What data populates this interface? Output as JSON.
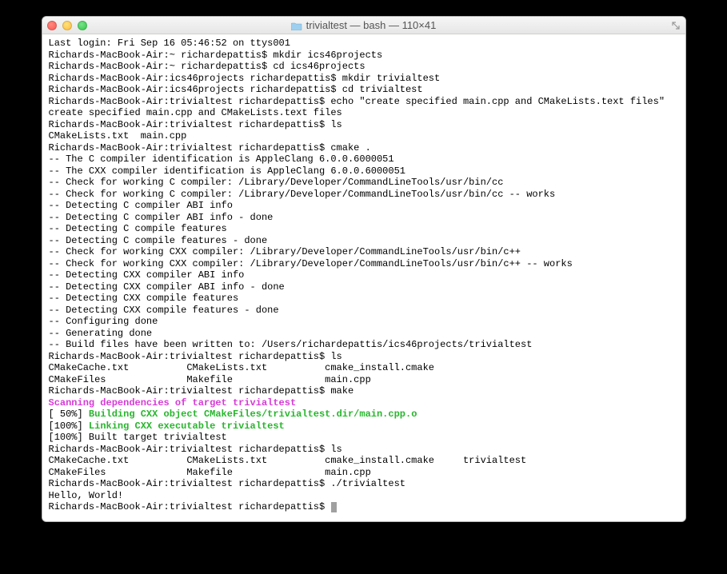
{
  "window": {
    "title": "trivialtest — bash — 110×41",
    "folder_icon": "folder-icon"
  },
  "traffic": {
    "close": "close",
    "minimize": "minimize",
    "zoom": "zoom"
  },
  "lines": [
    {
      "text": "Last login: Fri Sep 16 05:46:52 on ttys001"
    },
    {
      "text": "Richards-MacBook-Air:~ richardepattis$ mkdir ics46projects"
    },
    {
      "text": "Richards-MacBook-Air:~ richardepattis$ cd ics46projects"
    },
    {
      "text": "Richards-MacBook-Air:ics46projects richardepattis$ mkdir trivialtest"
    },
    {
      "text": "Richards-MacBook-Air:ics46projects richardepattis$ cd trivialtest"
    },
    {
      "text": "Richards-MacBook-Air:trivialtest richardepattis$ echo \"create specified main.cpp and CMakeLists.text files\""
    },
    {
      "text": "create specified main.cpp and CMakeLists.text files"
    },
    {
      "text": "Richards-MacBook-Air:trivialtest richardepattis$ ls"
    },
    {
      "text": "CMakeLists.txt  main.cpp"
    },
    {
      "text": "Richards-MacBook-Air:trivialtest richardepattis$ cmake ."
    },
    {
      "text": "-- The C compiler identification is AppleClang 6.0.0.6000051"
    },
    {
      "text": "-- The CXX compiler identification is AppleClang 6.0.0.6000051"
    },
    {
      "text": "-- Check for working C compiler: /Library/Developer/CommandLineTools/usr/bin/cc"
    },
    {
      "text": "-- Check for working C compiler: /Library/Developer/CommandLineTools/usr/bin/cc -- works"
    },
    {
      "text": "-- Detecting C compiler ABI info"
    },
    {
      "text": "-- Detecting C compiler ABI info - done"
    },
    {
      "text": "-- Detecting C compile features"
    },
    {
      "text": "-- Detecting C compile features - done"
    },
    {
      "text": "-- Check for working CXX compiler: /Library/Developer/CommandLineTools/usr/bin/c++"
    },
    {
      "text": "-- Check for working CXX compiler: /Library/Developer/CommandLineTools/usr/bin/c++ -- works"
    },
    {
      "text": "-- Detecting CXX compiler ABI info"
    },
    {
      "text": "-- Detecting CXX compiler ABI info - done"
    },
    {
      "text": "-- Detecting CXX compile features"
    },
    {
      "text": "-- Detecting CXX compile features - done"
    },
    {
      "text": "-- Configuring done"
    },
    {
      "text": "-- Generating done"
    },
    {
      "text": "-- Build files have been written to: /Users/richardepattis/ics46projects/trivialtest"
    },
    {
      "text": "Richards-MacBook-Air:trivialtest richardepattis$ ls"
    },
    {
      "text": "CMakeCache.txt          CMakeLists.txt          cmake_install.cmake"
    },
    {
      "text": "CMakeFiles              Makefile                main.cpp"
    },
    {
      "text": "Richards-MacBook-Air:trivialtest richardepattis$ make"
    },
    {
      "text": "Scanning dependencies of target trivialtest",
      "cls": "magenta"
    },
    {
      "prefix": "[ 50%] ",
      "text": "Building CXX object CMakeFiles/trivialtest.dir/main.cpp.o",
      "cls": "green"
    },
    {
      "prefix": "[100%] ",
      "text": "Linking CXX executable trivialtest",
      "cls": "green"
    },
    {
      "text": "[100%] Built target trivialtest"
    },
    {
      "text": "Richards-MacBook-Air:trivialtest richardepattis$ ls"
    },
    {
      "text": "CMakeCache.txt          CMakeLists.txt          cmake_install.cmake     trivialtest"
    },
    {
      "text": "CMakeFiles              Makefile                main.cpp"
    },
    {
      "text": "Richards-MacBook-Air:trivialtest richardepattis$ ./trivialtest"
    },
    {
      "text": "Hello, World!"
    },
    {
      "text": "Richards-MacBook-Air:trivialtest richardepattis$ ",
      "cursor": true
    }
  ]
}
